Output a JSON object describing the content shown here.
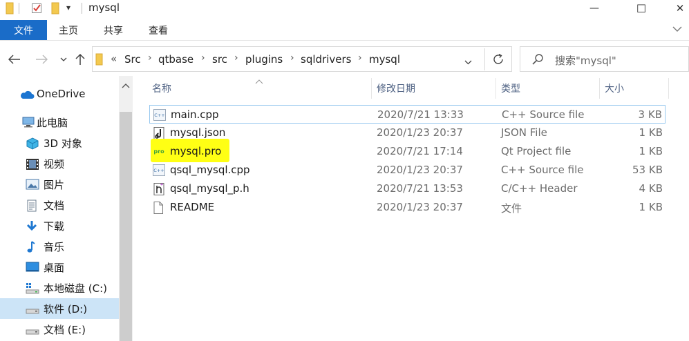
{
  "window": {
    "title": "mysql",
    "quick_access_dropdown": "▾",
    "minimize_glyph": "—",
    "maximize_glyph": "☐",
    "close_glyph": "✕"
  },
  "ribbon": {
    "file_tab": "文件",
    "tabs": [
      "主页",
      "共享",
      "查看"
    ]
  },
  "navigation": {
    "overflow_marker": "«",
    "breadcrumbs": [
      "Src",
      "qtbase",
      "src",
      "plugins",
      "sqldrivers",
      "mysql"
    ],
    "search_placeholder": "搜索\"mysql\""
  },
  "sidebar": {
    "items": [
      {
        "label": "OneDrive",
        "icon": "cloud-icon"
      },
      {
        "label": "此电脑",
        "icon": "computer-icon"
      },
      {
        "label": "3D 对象",
        "icon": "cube-icon"
      },
      {
        "label": "视频",
        "icon": "film-icon"
      },
      {
        "label": "图片",
        "icon": "picture-icon"
      },
      {
        "label": "文档",
        "icon": "document-icon"
      },
      {
        "label": "下载",
        "icon": "download-icon"
      },
      {
        "label": "音乐",
        "icon": "music-icon"
      },
      {
        "label": "桌面",
        "icon": "desktop-icon"
      },
      {
        "label": "本地磁盘 (C:)",
        "icon": "system-drive-icon"
      },
      {
        "label": "软件 (D:)",
        "icon": "drive-icon",
        "selected": true
      },
      {
        "label": "文档 (E:)",
        "icon": "drive-icon"
      }
    ]
  },
  "columns": {
    "name": "名称",
    "modified": "修改日期",
    "type": "类型",
    "size": "大小"
  },
  "files": [
    {
      "name": "main.cpp",
      "modified": "2020/7/21 13:33",
      "type": "C++ Source file",
      "size": "3 KB",
      "icon": "cpp-file-icon"
    },
    {
      "name": "mysql.json",
      "modified": "2020/1/23 20:37",
      "type": "JSON File",
      "size": "1 KB",
      "icon": "json-file-icon"
    },
    {
      "name": "mysql.pro",
      "modified": "2020/7/21 17:14",
      "type": "Qt Project file",
      "size": "1 KB",
      "icon": "qt-project-file-icon",
      "highlight_color": "#ffff14"
    },
    {
      "name": "qsql_mysql.cpp",
      "modified": "2020/1/23 20:37",
      "type": "C++ Source file",
      "size": "53 KB",
      "icon": "cpp-file-icon"
    },
    {
      "name": "qsql_mysql_p.h",
      "modified": "2020/7/21 13:53",
      "type": "C/C++ Header",
      "size": "4 KB",
      "icon": "header-file-icon"
    },
    {
      "name": "README",
      "modified": "2020/1/23 20:37",
      "type": "文件",
      "size": "1 KB",
      "icon": "generic-file-icon"
    }
  ],
  "icon_glyphs": {
    "cpp": "C++",
    "qt_project": "pro"
  },
  "colors": {
    "accent": "#1a6cc8",
    "selection": "#cce4f7",
    "highlight": "#ffff14",
    "folder": "#f3c94f"
  }
}
